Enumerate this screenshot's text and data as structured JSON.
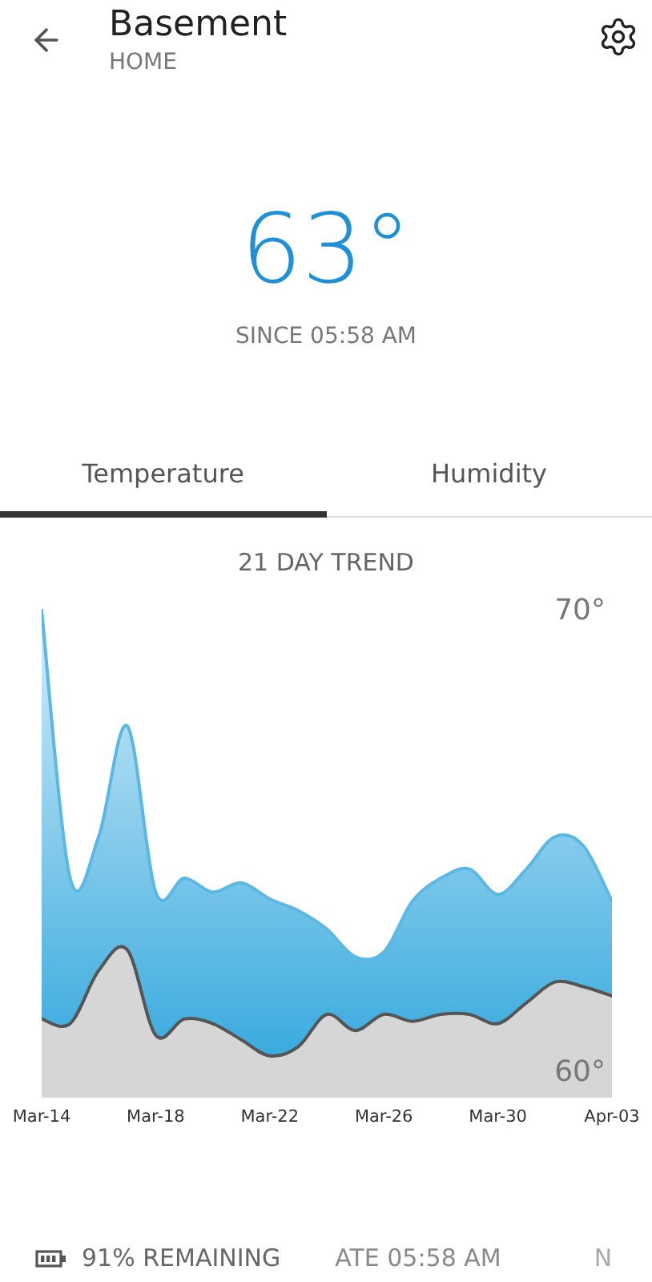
{
  "header": {
    "title": "Basement",
    "subtitle": "HOME"
  },
  "current": {
    "temperature": "63°",
    "since": "SINCE 05:58 AM"
  },
  "tabs": [
    {
      "label": "Temperature",
      "selected": true
    },
    {
      "label": "Humidity",
      "selected": false
    }
  ],
  "trend": {
    "title": "21 DAY TREND",
    "chart_data": {
      "type": "area",
      "categories": [
        "Mar-14",
        null,
        null,
        null,
        "Mar-18",
        null,
        null,
        null,
        "Mar-22",
        null,
        null,
        null,
        "Mar-26",
        null,
        null,
        null,
        "Mar-30",
        null,
        null,
        null,
        "Apr-03"
      ],
      "ylim": [
        60,
        70
      ],
      "yticks": [
        {
          "value": 70,
          "label": "70°"
        },
        {
          "value": 60,
          "label": "60°"
        }
      ],
      "series": [
        {
          "color": "#5bb8e4",
          "values": [
            70.0,
            64.2,
            65.1,
            67.5,
            63.9,
            64.2,
            63.9,
            64.1,
            63.75,
            63.5,
            63.1,
            62.5,
            62.6,
            63.7,
            64.2,
            64.4,
            63.85,
            64.4,
            65.1,
            64.9,
            63.7
          ]
        },
        {
          "color": "#555555",
          "values": [
            61.15,
            61.05,
            62.2,
            62.65,
            60.8,
            61.15,
            61.05,
            60.7,
            60.35,
            60.55,
            61.25,
            60.9,
            61.25,
            61.1,
            61.25,
            61.25,
            61.05,
            61.5,
            61.95,
            61.85,
            61.65
          ]
        }
      ]
    }
  },
  "ticker": [
    {
      "kind": "battery",
      "text": "91% REMAINING"
    },
    {
      "kind": "faded",
      "text": "ATE 05:58 AM"
    },
    {
      "kind": "faint",
      "text": "N"
    }
  ]
}
